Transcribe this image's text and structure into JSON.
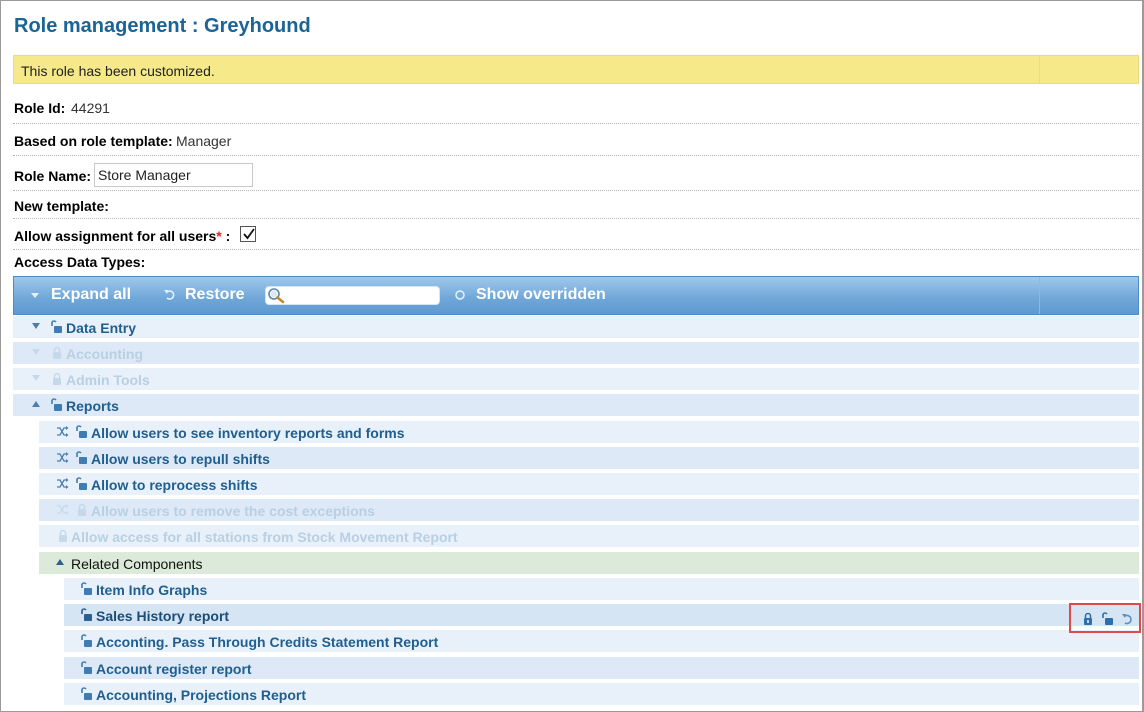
{
  "page": {
    "title": "Role management : Greyhound",
    "notice": "This role has been customized."
  },
  "fields": {
    "role_id_label": "Role Id:",
    "role_id_value": "44291",
    "template_label": "Based on role template:",
    "template_value": "Manager",
    "role_name_label": "Role Name:",
    "role_name_value": "Store Manager",
    "new_template_label": "New template:",
    "allow_assignment_label": "Allow assignment for all users",
    "allow_assignment_required": "*",
    "allow_assignment_colon": " :",
    "allow_assignment_checked": true,
    "access_types_label": "Access Data Types:"
  },
  "toolbar": {
    "expand_all": "Expand all",
    "restore": "Restore",
    "search_value": "",
    "show_overridden": "Show overridden"
  },
  "tree": [
    {
      "label": "Data Entry",
      "state": "enabled",
      "expander": "collapsed"
    },
    {
      "label": "Accounting",
      "state": "disabled",
      "expander": "collapsed"
    },
    {
      "label": "Admin Tools",
      "state": "disabled",
      "expander": "collapsed"
    },
    {
      "label": "Reports",
      "state": "enabled",
      "expander": "expanded"
    },
    {
      "label": "Allow users to see inventory reports and forms",
      "state": "enabled",
      "expander": "none"
    },
    {
      "label": "Allow users to repull shifts",
      "state": "enabled",
      "expander": "none"
    },
    {
      "label": "Allow to reprocess shifts",
      "state": "enabled",
      "expander": "none"
    },
    {
      "label": "Allow users to remove the cost exceptions",
      "state": "disabled",
      "expander": "none"
    },
    {
      "label": "Allow access for all stations from Stock Movement Report",
      "state": "disabled",
      "expander": "none"
    },
    {
      "label": "Related Components",
      "state": "group",
      "expander": "expanded"
    },
    {
      "label": "Item Info Graphs",
      "state": "enabled",
      "expander": "none"
    },
    {
      "label": "Sales History report",
      "state": "selected",
      "expander": "none"
    },
    {
      "label": "Acconting. Pass Through Credits Statement Report",
      "state": "enabled",
      "expander": "none"
    },
    {
      "label": "Account register report",
      "state": "enabled",
      "expander": "none"
    },
    {
      "label": "Accounting, Projections Report",
      "state": "enabled",
      "expander": "none"
    }
  ],
  "row_actions": {
    "icons": [
      "lock-icon",
      "unlock-icon",
      "restore-icon"
    ]
  },
  "colors": {
    "accent": "#1a6496",
    "notice_bg": "#f5e98a",
    "toolbar_bg": "#6ea6d8",
    "highlight": "#e04a4a"
  }
}
